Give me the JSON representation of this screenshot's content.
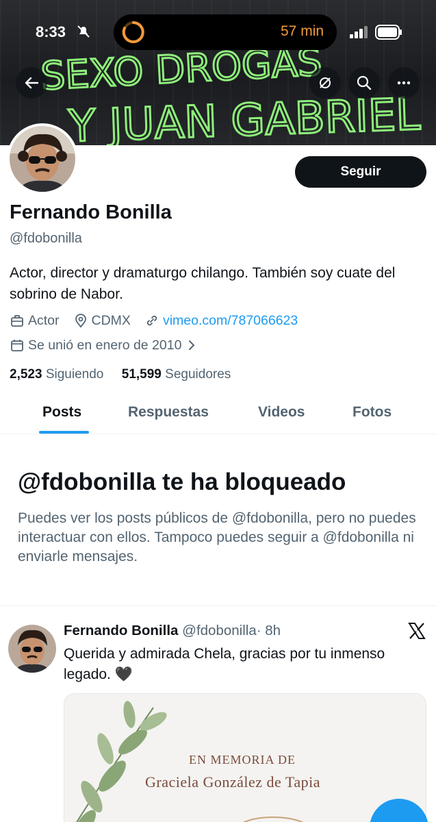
{
  "status_bar": {
    "time": "8:33",
    "activity_text": "57 min"
  },
  "banner": {
    "graffiti_line1": "SEXO DROGAS",
    "graffiti_line2": "Y JUAN GABRIEL"
  },
  "header_icons": [
    "back-arrow-icon",
    "no-retweets-icon",
    "search-icon",
    "more-icon"
  ],
  "profile": {
    "follow_label": "Seguir",
    "name": "Fernando Bonilla",
    "handle": "@fdobonilla",
    "bio": "Actor, director y dramaturgo chilango. También soy cuate del sobrino de Nabor.",
    "profession": "Actor",
    "location": "CDMX",
    "website": "vimeo.com/787066623",
    "joined": "Se unió en enero de 2010",
    "following_count": "2,523",
    "following_label": "Siguiendo",
    "followers_count": "51,599",
    "followers_label": "Seguidores"
  },
  "tabs": [
    {
      "label": "Posts",
      "active": true
    },
    {
      "label": "Respuestas",
      "active": false
    },
    {
      "label": "Videos",
      "active": false
    },
    {
      "label": "Fotos",
      "active": false
    }
  ],
  "blocked": {
    "title": "@fdobonilla te ha bloqueado",
    "text": "Puedes ver los posts públicos de @fdobonilla, pero no puedes interactuar con ellos. Tampoco puedes seguir a @fdobonilla ni enviarle mensajes."
  },
  "post": {
    "author_name": "Fernando Bonilla",
    "author_handle": "@fdobonilla",
    "time": "· 8h",
    "text": "Querida y admirada Chela, gracias por tu inmenso legado. 🖤",
    "media_line1": "EN MEMORIA DE",
    "media_line2": "Graciela González de Tapia"
  },
  "colors": {
    "accent": "#1d9bf0",
    "text": "#0f1419",
    "secondary": "#536471",
    "graffiti": "#8ef07a",
    "timer": "#f29a3a"
  }
}
